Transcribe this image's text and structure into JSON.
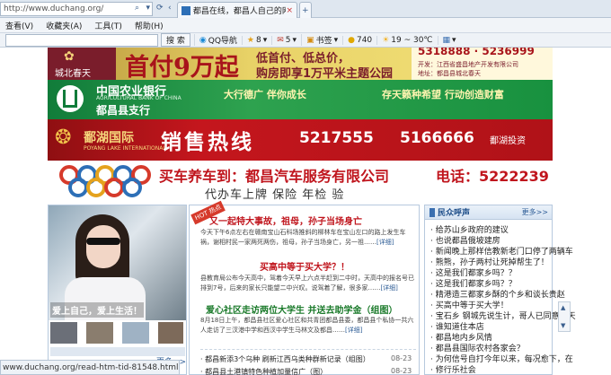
{
  "browser": {
    "address_url": "http://www.duchang.org/",
    "tab_title": "都昌在线，都昌人自己的网…"
  },
  "menu": {
    "items": [
      "查看(V)",
      "收藏夹(A)",
      "工具(T)",
      "帮助(H)"
    ]
  },
  "toolbar": {
    "search_label": "搜 索",
    "qq_label": "QQ导航",
    "star_count": "8",
    "mail_count": "5",
    "bookmark_label": "书签",
    "coin_count": "740",
    "weather_label": "19 ~ 30℃"
  },
  "banners": {
    "b1": {
      "brand": "城北春天",
      "headline": "首付9万起",
      "sub1": "低首付、低总价，",
      "sub2": "购房即享1万平米主题公园",
      "phone": "5318888 · 5236999",
      "note1": "开发：江西省盛昌地产开发有限公司",
      "note2": "地址：都昌县城北春天"
    },
    "b2": {
      "bank_cn": "中国农业银行",
      "bank_en": "AGRICULTURAL BANK OF CHINA",
      "branch": "都昌县支行",
      "slogan1": "大行德广  伴你成长",
      "slogan2": "存天籁种希望  行动创造财富"
    },
    "b3": {
      "brand": "鄱湖国际",
      "brand_en": "POYANG LAKE INTERNATIONAL",
      "headline": "销售热线",
      "phone1": "5217555",
      "phone2": "5166666",
      "partner": "鄱湖投资"
    },
    "b4": {
      "headline": "买车养车到：都昌汽车服务有限公司",
      "phone_label": "电话：5222239",
      "services": "代办车上牌  保险  年检  验"
    }
  },
  "photo": {
    "caption": "爱上自己，爱上生活！"
  },
  "news": {
    "badge": "HOT 热点",
    "items": [
      {
        "title": "又一起特大事故，祖母，孙子当场身亡",
        "body": "今天下午6点左右在赣南宝山石科场推斜的柳林车在宝山左口的路上发生车祸，谢相村民一家两死两伤，祖母，孙子当场身亡，另一祖……",
        "more": "[详细]"
      },
      {
        "title": "买高中等于买大学？！",
        "body": "县教育局公布今天高中，驾着今天早上六点半赶到二中时，天高中的报名号已排到7号，后来的家长只能望二中兴叹。说驾着了解，很多家……",
        "more": "[详细]"
      },
      {
        "title": "爱心社区走访两位大学生 并送去助学金（组图）",
        "body": "8月18日上午，都昌县社区爱心社区和共青团都昌县委，都昌县个私协一共六人走访了三汊港中学和西汊中学生马林文及都昌……",
        "more": "[详细]"
      }
    ],
    "list": [
      {
        "text": "都昌新添3个乌种 刷新江西乌类种群新记录（组图）",
        "date": "08-23"
      },
      {
        "text": "都昌县土港镇特色种植加量信广（图）",
        "date": "08-23"
      }
    ]
  },
  "voice": {
    "title": "民众呼声",
    "more": "更多>>",
    "items": [
      "给苏山乡政府的建议",
      "也说都昌俄坡建房",
      "新闻晚上那样信教新老门口停了两辆车",
      "熊熊，孙子两村让死掉帮生了！",
      "这是我们都家乡吗？？",
      "这是我们都家乡吗？？",
      "精港造三都家乡酥的个乡和谈长贵赵",
      "买高中等于买大学！",
      "宝石乡 钢城先说生计，哥人已同意明天",
      "谁知道住本店",
      "都昌地内乡风情",
      "都昌县国际农村各家会？",
      "为何信号自打今年以来，每况愈下，在",
      "修行乐社会"
    ]
  },
  "bottom_left": {
    "more1": "更多>>",
    "more2": "更多>>"
  },
  "statusbar": {
    "text": "www.duchang.org/read-htm-tid-81548.html"
  }
}
